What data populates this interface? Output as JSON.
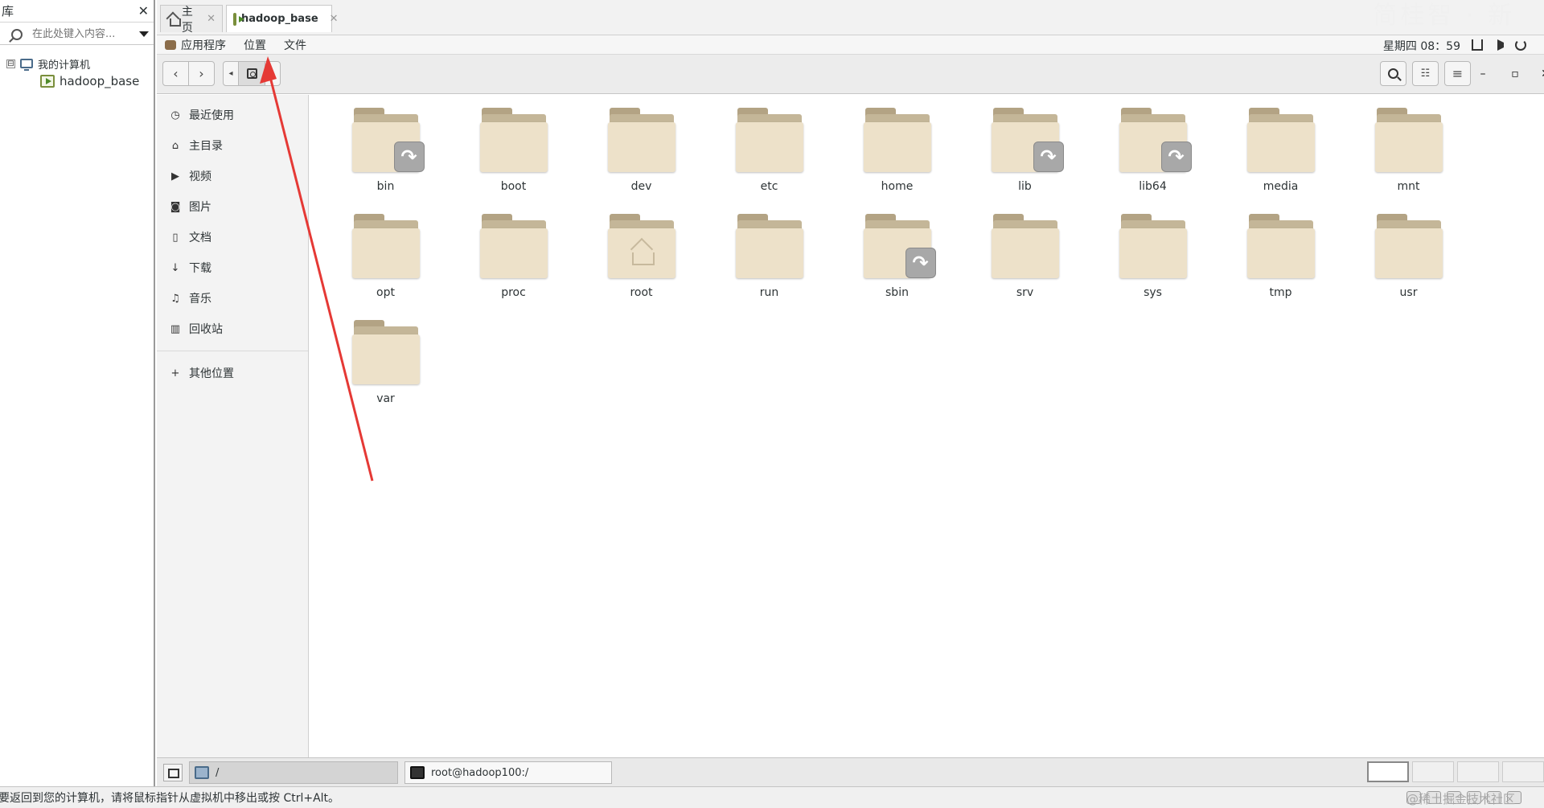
{
  "library": {
    "title": "库",
    "close_label": "✕",
    "search_placeholder": "在此处键入内容...",
    "tree": {
      "root_toggle": "⊟",
      "root_label": "我的计算机",
      "child_label": "hadoop_base"
    }
  },
  "vm_tabs": [
    {
      "label": "主页",
      "close": "✕"
    },
    {
      "label": "hadoop_base",
      "close": "✕"
    }
  ],
  "top_watermark": "简桂智 · 新",
  "topbar": {
    "menus": [
      "应用程序",
      "位置",
      "文件"
    ],
    "clock": "星期四 08：59"
  },
  "headerbar": {
    "back": "‹",
    "forward": "›",
    "path_left": "◂",
    "path_right": "▸",
    "view_icon": "☷",
    "menu_icon": "≡",
    "min": "–",
    "max": "▫",
    "close": "✕"
  },
  "sidebar": {
    "items": [
      {
        "label": "最近使用",
        "icon": "◷"
      },
      {
        "label": "主目录",
        "icon": "⌂"
      },
      {
        "label": "视频",
        "icon": "▶"
      },
      {
        "label": "图片",
        "icon": "◙"
      },
      {
        "label": "文档",
        "icon": "▯"
      },
      {
        "label": "下载",
        "icon": "↓"
      },
      {
        "label": "音乐",
        "icon": "♫"
      },
      {
        "label": "回收站",
        "icon": "▥"
      }
    ],
    "other": {
      "label": "其他位置",
      "icon": "+"
    }
  },
  "folders": [
    {
      "name": "bin",
      "link": true
    },
    {
      "name": "boot"
    },
    {
      "name": "dev"
    },
    {
      "name": "etc"
    },
    {
      "name": "home"
    },
    {
      "name": "lib",
      "link": true
    },
    {
      "name": "lib64",
      "link": true
    },
    {
      "name": "media"
    },
    {
      "name": "mnt"
    },
    {
      "name": "opt"
    },
    {
      "name": "proc"
    },
    {
      "name": "root",
      "home": true
    },
    {
      "name": "run"
    },
    {
      "name": "sbin",
      "link": true
    },
    {
      "name": "srv"
    },
    {
      "name": "sys"
    },
    {
      "name": "tmp"
    },
    {
      "name": "usr"
    },
    {
      "name": "var"
    }
  ],
  "link_glyph": "↷",
  "taskbar": {
    "files_task": "/",
    "terminal_task": "root@hadoop100:/"
  },
  "statusbar": {
    "message": "要返回到您的计算机，请将鼠标指针从虚拟机中移出或按 Ctrl+Alt。",
    "watermark": "@稀土掘金技术社区"
  },
  "colors": {
    "annotation_arrow": "#e53935",
    "folder_front": "#ede1c9",
    "folder_back": "#c4b698"
  }
}
